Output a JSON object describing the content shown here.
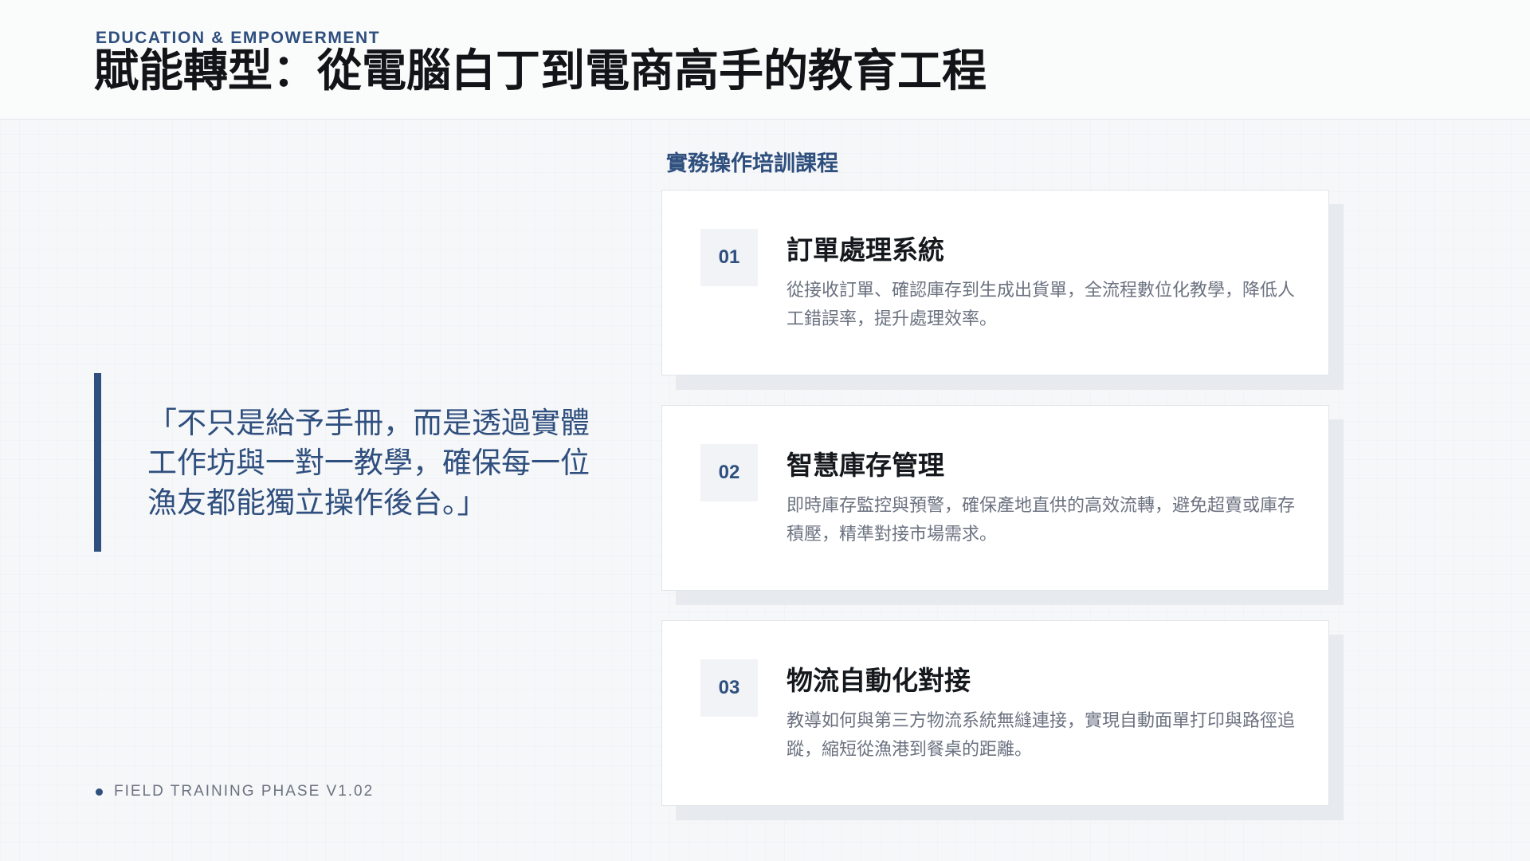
{
  "header": {
    "eyebrow": "EDUCATION & EMPOWERMENT",
    "title": "賦能轉型：從電腦白丁到電商高手的教育工程"
  },
  "quote": {
    "text": "「不只是給予手冊，而是透過實體工作坊與一對一教學，確保每一位漁友都能獨立操作後台。」"
  },
  "footer": {
    "text": "FIELD TRAINING PHASE V1.02"
  },
  "section": {
    "label": "實務操作培訓課程"
  },
  "cards": [
    {
      "number": "01",
      "title": "訂單處理系統",
      "description": "從接收訂單、確認庫存到生成出貨單，全流程數位化教學，降低人工錯誤率，提升處理效率。"
    },
    {
      "number": "02",
      "title": "智慧庫存管理",
      "description": "即時庫存監控與預警，確保產地直供的高效流轉，避免超賣或庫存積壓，精準對接市場需求。"
    },
    {
      "number": "03",
      "title": "物流自動化對接",
      "description": "教導如何與第三方物流系統無縫連接，實現自動面單打印與路徑追蹤，縮短從漁港到餐桌的距離。"
    }
  ],
  "colors": {
    "accent": "#2f4f7e",
    "background": "#f6f7f9",
    "card": "#ffffff",
    "muted_text": "#6b7280"
  }
}
